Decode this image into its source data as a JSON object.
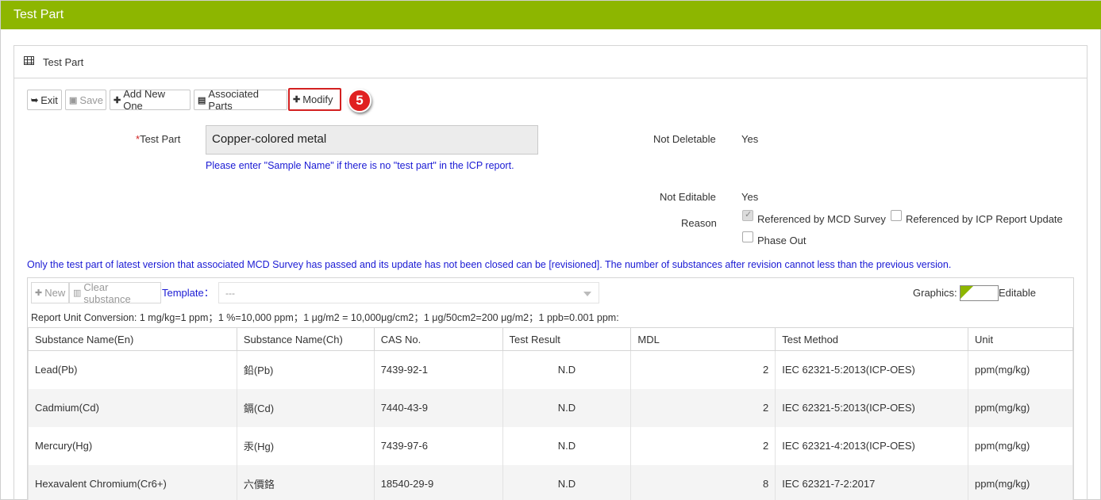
{
  "header": {
    "title": "Test Part"
  },
  "panel": {
    "title": "Test Part"
  },
  "toolbar": {
    "exit": "Exit",
    "save": "Save",
    "add_new": "Add New One",
    "associated": "Associated Parts",
    "modify": "Modify",
    "step_marker": "5"
  },
  "form": {
    "test_part_label": "Test Part",
    "test_part_value": "Copper-colored metal",
    "test_part_hint": "Please enter \"Sample Name\" if there is no \"test part\" in the ICP report.",
    "not_deletable_label": "Not Deletable",
    "not_deletable_value": "Yes",
    "not_editable_label": "Not Editable",
    "not_editable_value": "Yes",
    "reason_label": "Reason",
    "reasons": [
      {
        "label": "Referenced by MCD Survey",
        "checked": true
      },
      {
        "label": "Referenced by ICP Report Update",
        "checked": false
      },
      {
        "label": "Phase Out",
        "checked": false
      }
    ]
  },
  "notice": "Only the test part of latest version that associated MCD Survey has passed and its update has not been closed can be [revisioned]. The number of substances after revision cannot less than the previous version.",
  "substances": {
    "new_btn": "New",
    "clear_btn": "Clear substance",
    "template_label": "Template：",
    "template_value": "---",
    "graphics_label": "Graphics:",
    "editable_label": "Editable",
    "conversion": "Report Unit Conversion: 1 mg/kg=1 ppm；1 %=10,000 ppm；1 μg/m2 = 10,000μg/cm2；1 μg/50cm2=200 μg/m2；1 ppb=0.001 ppm:",
    "columns": [
      "Substance Name(En)",
      "Substance Name(Ch)",
      "CAS No.",
      "Test Result",
      "MDL",
      "Test Method",
      "Unit"
    ],
    "rows": [
      [
        "Lead(Pb)",
        "鉛(Pb)",
        "7439-92-1",
        "N.D",
        "2",
        "IEC 62321-5:2013(ICP-OES)",
        "ppm(mg/kg)"
      ],
      [
        "Cadmium(Cd)",
        "鎘(Cd)",
        "7440-43-9",
        "N.D",
        "2",
        "IEC 62321-5:2013(ICP-OES)",
        "ppm(mg/kg)"
      ],
      [
        "Mercury(Hg)",
        "汞(Hg)",
        "7439-97-6",
        "N.D",
        "2",
        "IEC 62321-4:2013(ICP-OES)",
        "ppm(mg/kg)"
      ],
      [
        "Hexavalent Chromium(Cr6+)",
        "六價鉻",
        "18540-29-9",
        "N.D",
        "8",
        "IEC 62321-7-2:2017",
        "ppm(mg/kg)"
      ]
    ]
  },
  "colors": {
    "brand": "#8db600",
    "highlight": "#d32020",
    "hint": "#1a1ad4"
  }
}
